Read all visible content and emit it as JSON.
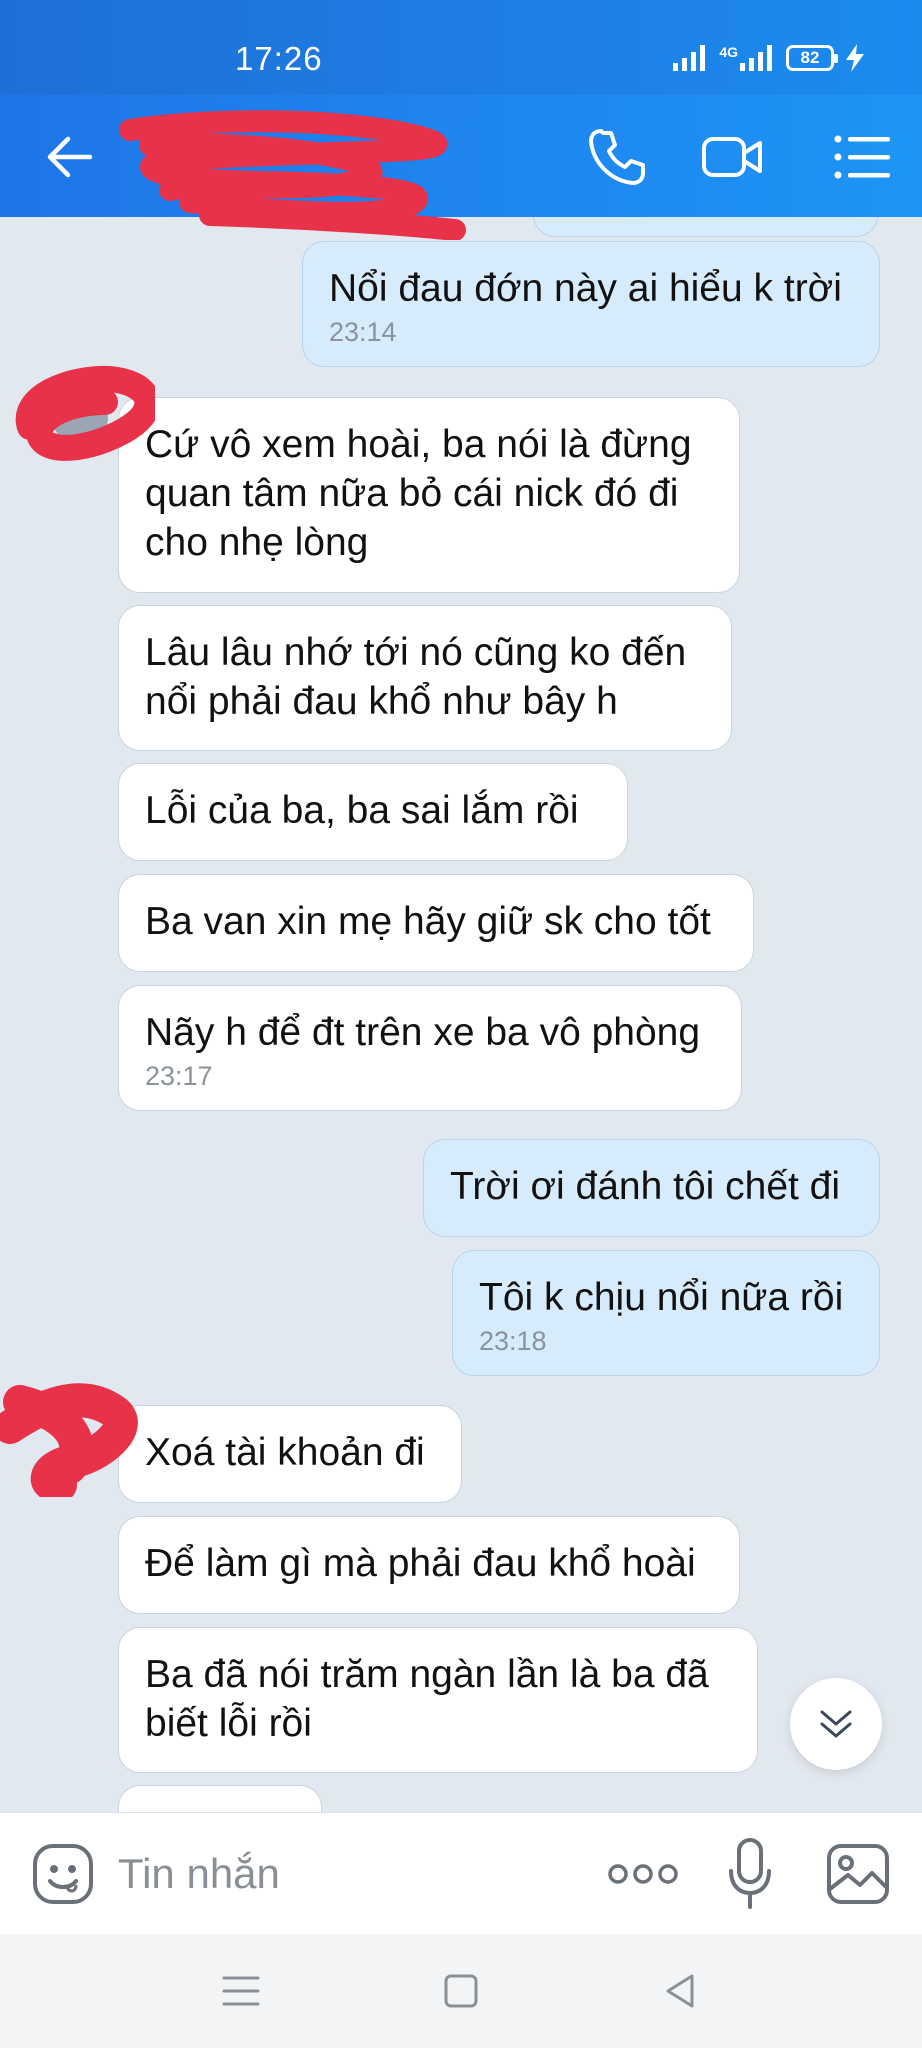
{
  "status_bar": {
    "time": "17:26",
    "network": "4G",
    "battery": "82"
  },
  "header": {
    "contact_name": ""
  },
  "messages": [
    {
      "dir": "out",
      "text": "Nổi đau đớn này ai hiểu k trời",
      "time": "23:14"
    },
    {
      "dir": "in",
      "text": "Cứ vô xem hoài, ba nói là đừng\nquan tâm nữa bỏ cái nick đó đi\ncho nhẹ lòng",
      "time": ""
    },
    {
      "dir": "in",
      "text": "Lâu lâu nhớ tới nó cũng ko đến\nnổi phải đau khổ như bây h",
      "time": ""
    },
    {
      "dir": "in",
      "text": "Lỗi của ba, ba sai lắm rồi",
      "time": ""
    },
    {
      "dir": "in",
      "text": "Ba van xin mẹ hãy giữ sk cho tốt",
      "time": ""
    },
    {
      "dir": "in",
      "text": "Nãy h để đt trên xe ba vô phòng",
      "time": "23:17"
    },
    {
      "dir": "out",
      "text": "Trời ơi đánh tôi chết đi",
      "time": ""
    },
    {
      "dir": "out",
      "text": "Tôi k chịu nổi nữa rồi",
      "time": "23:18"
    },
    {
      "dir": "in",
      "text": "Xoá tài khoản đi",
      "time": ""
    },
    {
      "dir": "in",
      "text": "Để làm gì mà phải đau khổ hoài",
      "time": ""
    },
    {
      "dir": "in",
      "text": "Ba đã nói trăm ngàn lần là ba đã\nbiết lỗi rồi",
      "time": ""
    },
    {
      "dir": "in",
      "text": "",
      "time": ""
    }
  ],
  "composer": {
    "placeholder": "Tin nhắn"
  },
  "icons": {
    "back": "back-arrow-icon",
    "call": "phone-icon",
    "video": "video-camera-icon",
    "menu": "list-menu-icon",
    "emoji": "emoji-icon",
    "more": "more-dots-icon",
    "mic": "microphone-icon",
    "image": "image-icon",
    "scroll_down": "double-chevron-down-icon"
  },
  "colors": {
    "header": "#1d88f2",
    "chat_bg": "#e2e8ef",
    "outgoing_bubble": "#d6ecfc",
    "incoming_bubble": "#ffffff",
    "redaction": "#e8324a"
  }
}
